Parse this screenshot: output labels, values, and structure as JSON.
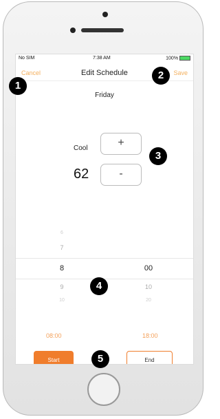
{
  "status_bar": {
    "carrier": "No SIM",
    "time": "7:38 AM",
    "battery": "100%"
  },
  "nav": {
    "cancel": "Cancel",
    "title": "Edit Schedule",
    "save": "Save"
  },
  "day": "Friday",
  "mode_label": "Cool",
  "temperature": "62",
  "plus_label": "+",
  "minus_label": "-",
  "picker": {
    "hours": [
      "6",
      "7",
      "8",
      "9",
      "10"
    ],
    "minutes": [
      "00",
      "10",
      "20"
    ]
  },
  "times": {
    "start": "08:00",
    "end": "18:00"
  },
  "buttons": {
    "start": "Start",
    "end": "End"
  },
  "markers": [
    "1",
    "2",
    "3",
    "4",
    "5"
  ],
  "colors": {
    "accent": "#f07d2c",
    "accent_light": "#f4b05e"
  }
}
